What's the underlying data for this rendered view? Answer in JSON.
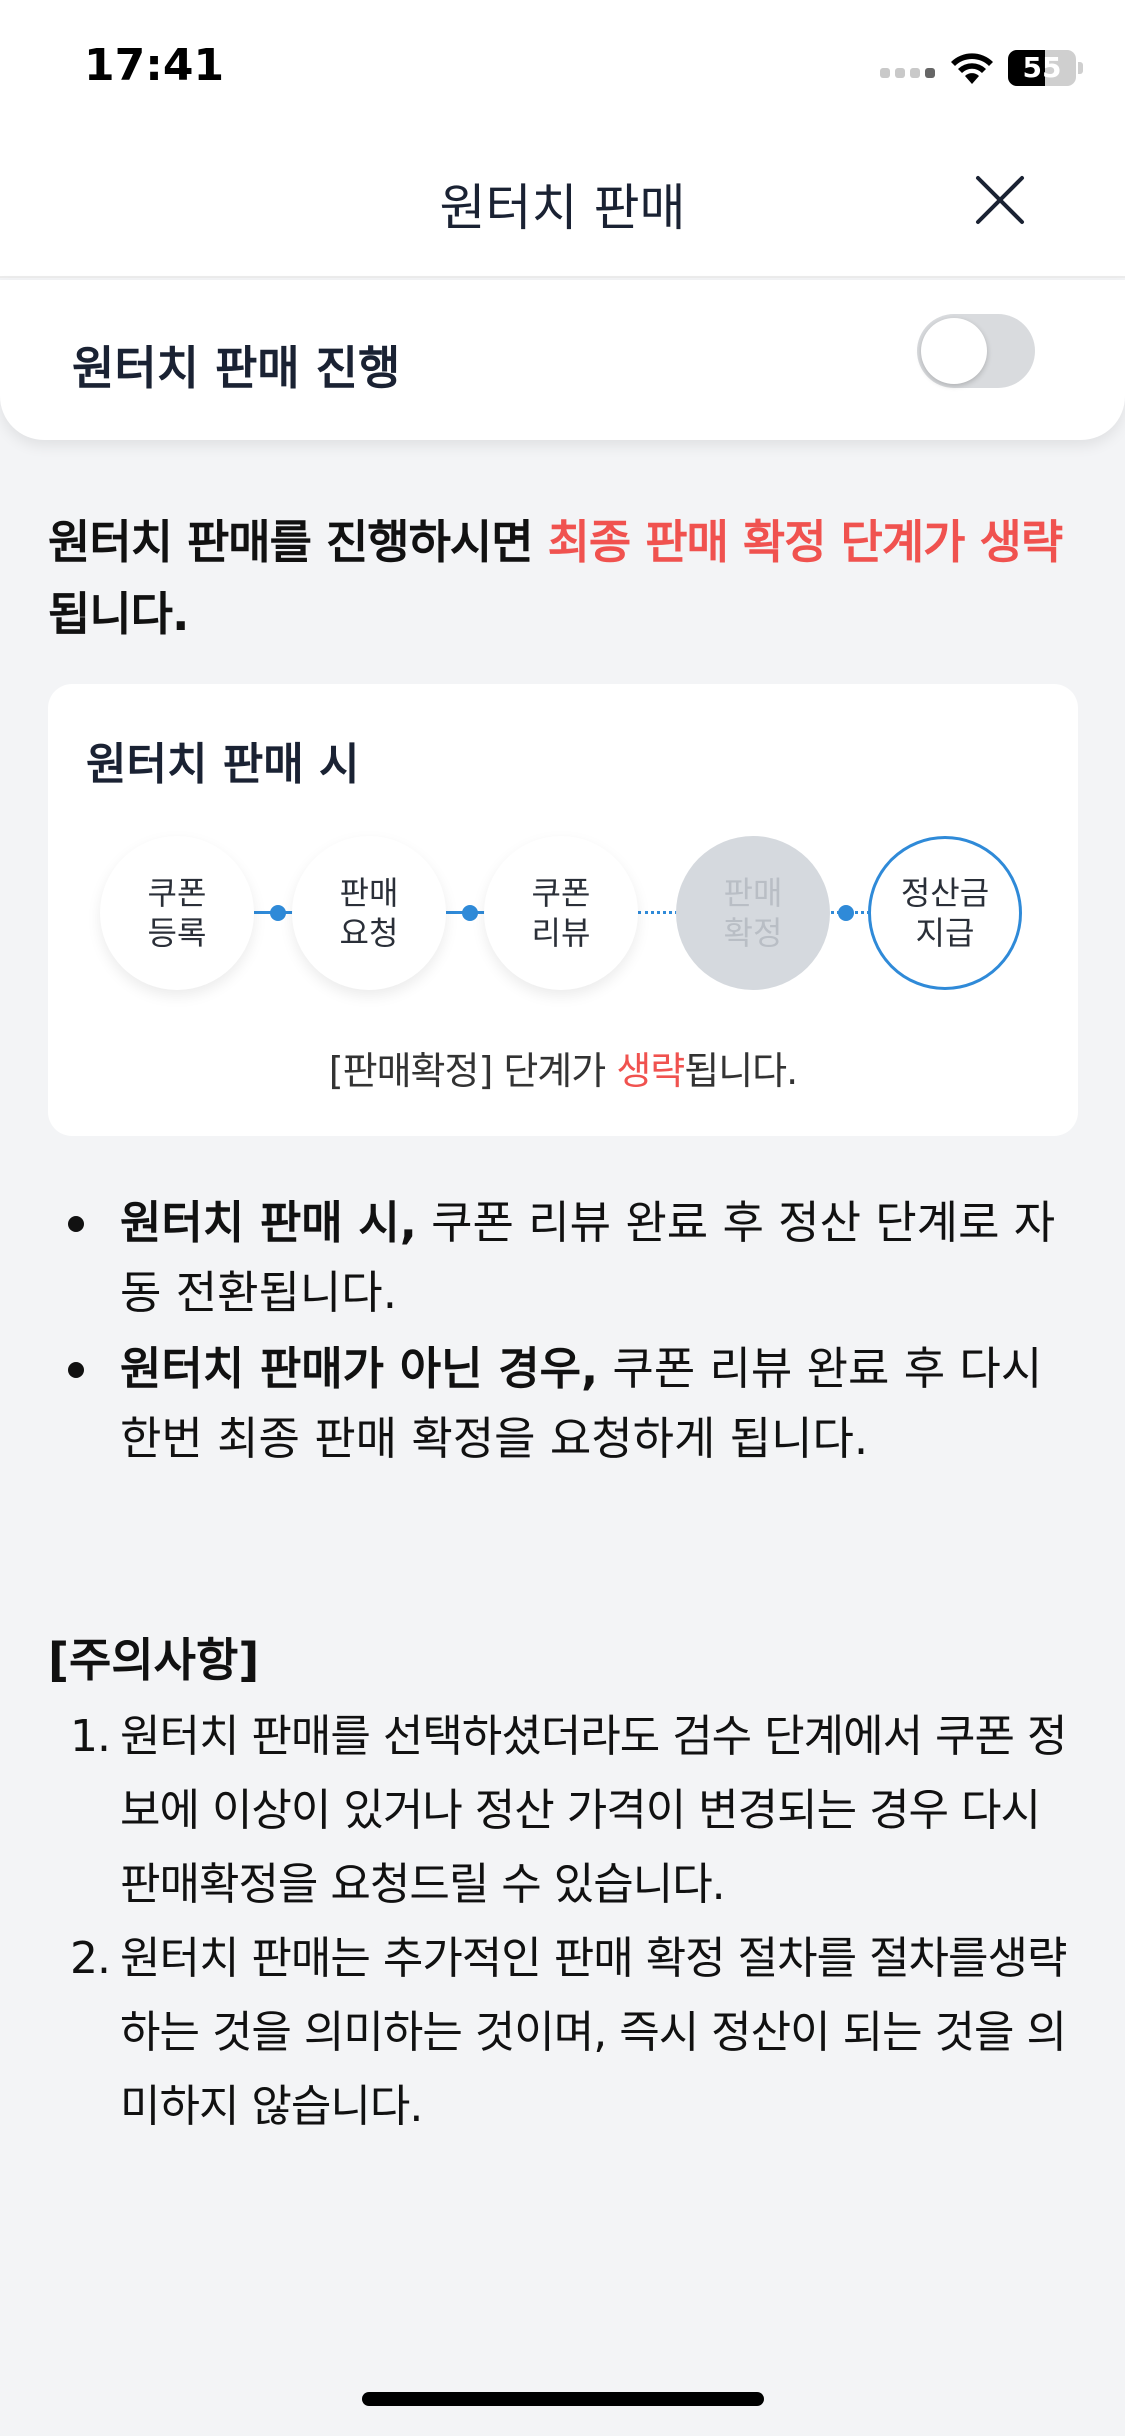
{
  "status_bar": {
    "time": "17:41",
    "battery": "55",
    "battery_level": 0.55
  },
  "header": {
    "title": "원터치 판매"
  },
  "toggle": {
    "label": "원터치 판매 진행",
    "on": false
  },
  "intro": {
    "prefix": "원터치 판매를 진행하시면 ",
    "highlight": "최종 판매 확정 단계가 생략",
    "suffix": "됩니다."
  },
  "process": {
    "title": "원터치 판매 시",
    "steps": [
      {
        "label": "쿠폰\n등록"
      },
      {
        "label": "판매\n요청"
      },
      {
        "label": "쿠폰\n리뷰"
      },
      {
        "label": "판매\n확정"
      },
      {
        "label": "정산금\n지급"
      }
    ],
    "note_prefix": "[판매확정] 단계가 ",
    "note_highlight": "생략",
    "note_suffix": "됩니다."
  },
  "bullets": [
    {
      "bold": "원터치 판매 시,",
      "text": " 쿠폰 리뷰 완료 후 정산 단계로 자동 전환됩니다."
    },
    {
      "bold": "원터치 판매가 아닌 경우,",
      "text": " 쿠폰 리뷰 완료 후 다시 한번 최종 판매 확정을 요청하게 됩니다."
    }
  ],
  "caution": {
    "title": "[주의사항]",
    "items": [
      {
        "num": "1.",
        "text": "원터치 판매를 선택하셨더라도 검수 단계에서 쿠폰 정보에 이상이 있거나 정산 가격이 변경되는 경우 다시 판매확정을 요청드릴 수 있습니다."
      },
      {
        "num": "2.",
        "text": "원터치 판매는 추가적인 판매 확정 절차를 절차를생략하는 것을 의미하는 것이며, 즉시 정산이 되는 것을 의미하지 않습니다."
      }
    ]
  },
  "colors": {
    "accent": "#2f8ad8",
    "highlight": "#f0524f",
    "toggle_off": "#d9dbde"
  },
  "icons": {
    "close": "close-icon",
    "wifi": "wifi-icon",
    "battery": "battery-icon",
    "signal": "signal-icon"
  }
}
